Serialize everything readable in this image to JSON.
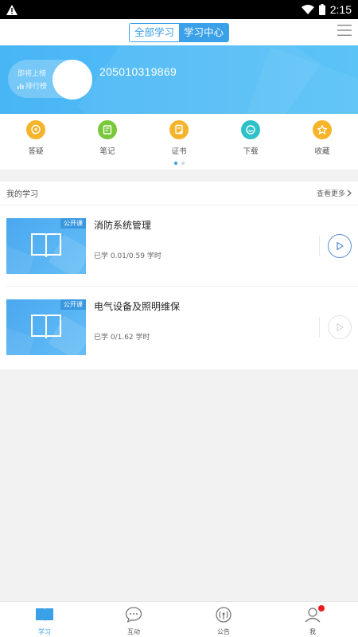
{
  "status_bar": {
    "time": "2:15",
    "alert_icon": "warning-icon",
    "wifi_icon": "wifi-icon",
    "battery_icon": "battery-icon"
  },
  "header": {
    "tabs": [
      {
        "label": "全部学习",
        "active": false
      },
      {
        "label": "学习中心",
        "active": true
      }
    ],
    "menu_icon": "hamburger-icon",
    "accent": "#3aa0e8"
  },
  "profile": {
    "rank_line1": "即将上榜",
    "rank_line2": "排行榜",
    "user_id": "205010319869",
    "banner_color": "#48b5f5"
  },
  "quick_actions": [
    {
      "label": "答疑",
      "icon": "question-bubble-icon",
      "color": "#f5b42a"
    },
    {
      "label": "笔记",
      "icon": "note-icon",
      "color": "#79c83b"
    },
    {
      "label": "证书",
      "icon": "certificate-icon",
      "color": "#f5b42a"
    },
    {
      "label": "下载",
      "icon": "download-icon",
      "color": "#2fc1c9"
    },
    {
      "label": "收藏",
      "icon": "star-icon",
      "color": "#f5b42a"
    }
  ],
  "pager": {
    "pages": 2,
    "current": 1
  },
  "my_learning": {
    "title": "我的学习",
    "more_label": "查看更多",
    "courses": [
      {
        "title": "消防系统管理",
        "tag": "公开课",
        "progress": "已学 0.01/0.59 学时",
        "play_active": true
      },
      {
        "title": "电气设备及照明维保",
        "tag": "公开课",
        "progress": "已学 0/1.62 学时",
        "play_active": false
      }
    ]
  },
  "bottom_nav": [
    {
      "label": "学习",
      "icon": "book-icon",
      "active": true
    },
    {
      "label": "互动",
      "icon": "chat-icon",
      "active": false
    },
    {
      "label": "公告",
      "icon": "broadcast-icon",
      "active": false
    },
    {
      "label": "我",
      "icon": "person-icon",
      "active": false,
      "badge": true
    }
  ]
}
